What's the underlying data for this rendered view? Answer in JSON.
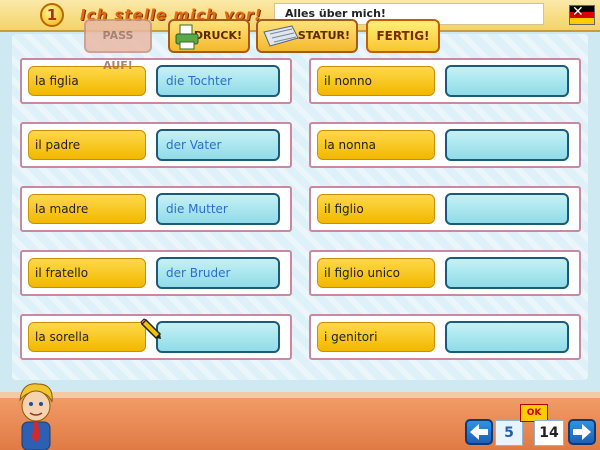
{
  "header": {
    "lesson_number": "1",
    "title": "Ich stelle mich vor!",
    "subtitle": "Alles über mich!"
  },
  "pairs": {
    "left": [
      {
        "italian": "la figlia",
        "german": "die Tochter"
      },
      {
        "italian": "il padre",
        "german": "der Vater"
      },
      {
        "italian": "la madre",
        "german": "die Mutter"
      },
      {
        "italian": "il fratello",
        "german": "der Bruder"
      },
      {
        "italian": "la sorella",
        "german": ""
      }
    ],
    "right": [
      {
        "italian": "il nonno",
        "german": ""
      },
      {
        "italian": "la nonna",
        "german": ""
      },
      {
        "italian": "il figlio",
        "german": ""
      },
      {
        "italian": "il figlio unico",
        "german": ""
      },
      {
        "italian": "i genitori",
        "german": ""
      }
    ]
  },
  "footer": {
    "pass_auf_label": "PASS AUF!",
    "druck_label": "DRUCK!",
    "tastatur_label": "TASTATUR!",
    "fertig_label": "FERTIG!",
    "ok_label": "OK",
    "page_current": "5",
    "page_total": "14"
  },
  "icons": [
    "flag-de-icon",
    "pencil-cursor-icon",
    "printer-icon",
    "keyboard-icon",
    "arrow-left-icon",
    "arrow-right-icon",
    "mascot-icon"
  ]
}
